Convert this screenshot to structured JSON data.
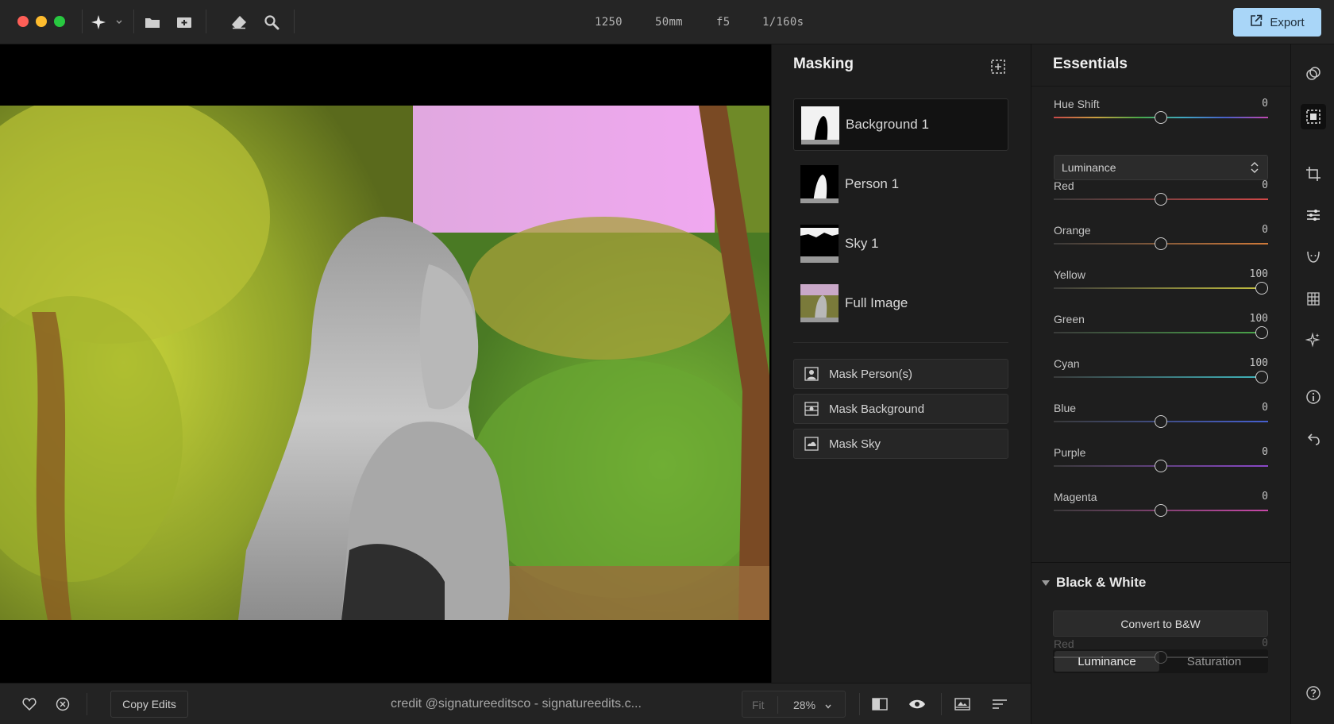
{
  "toolbar": {
    "exif": {
      "iso": "1250",
      "focal": "50mm",
      "aperture": "f5",
      "shutter": "1/160s"
    },
    "export_label": "Export",
    "icons": [
      "ai-sparkle-icon",
      "folder-icon",
      "add-photo-icon",
      "eraser-icon",
      "search-icon"
    ]
  },
  "masking": {
    "title": "Masking",
    "masks": [
      {
        "label": "Background 1",
        "selected": true
      },
      {
        "label": "Person 1",
        "selected": false
      },
      {
        "label": "Sky 1",
        "selected": false
      },
      {
        "label": "Full Image",
        "selected": false
      }
    ],
    "actions": [
      {
        "label": "Mask Person(s)",
        "icon": "person-icon"
      },
      {
        "label": "Mask Background",
        "icon": "background-icon"
      },
      {
        "label": "Mask Sky",
        "icon": "sky-icon"
      }
    ]
  },
  "essentials": {
    "title": "Essentials",
    "hue_shift": {
      "label": "Hue Shift",
      "value": "0",
      "position": 0.5
    },
    "channel_dropdown": "Luminance",
    "sliders": [
      {
        "label": "Red",
        "value": "0",
        "position": 0.5,
        "color": "#d04848"
      },
      {
        "label": "Orange",
        "value": "0",
        "position": 0.5,
        "color": "#d07a3a"
      },
      {
        "label": "Yellow",
        "value": "100",
        "position": 0.97,
        "color": "#c8c440"
      },
      {
        "label": "Green",
        "value": "100",
        "position": 0.97,
        "color": "#4aa84a"
      },
      {
        "label": "Cyan",
        "value": "100",
        "position": 0.97,
        "color": "#40b8c0"
      },
      {
        "label": "Blue",
        "value": "0",
        "position": 0.5,
        "color": "#4660d0"
      },
      {
        "label": "Purple",
        "value": "0",
        "position": 0.5,
        "color": "#8a48c8"
      },
      {
        "label": "Magenta",
        "value": "0",
        "position": 0.5,
        "color": "#c848a8"
      }
    ],
    "black_white": {
      "title": "Black & White",
      "convert_label": "Convert to B&W",
      "tabs": [
        "Luminance",
        "Saturation"
      ],
      "active_tab": "Luminance",
      "first_slider": {
        "label": "Red",
        "value": "0",
        "position": 0.5
      }
    }
  },
  "bottom": {
    "copy_edits": "Copy Edits",
    "credit": "credit @signatureeditsco - signatureedits.c...",
    "fit_label": "Fit",
    "zoom": "28%"
  }
}
